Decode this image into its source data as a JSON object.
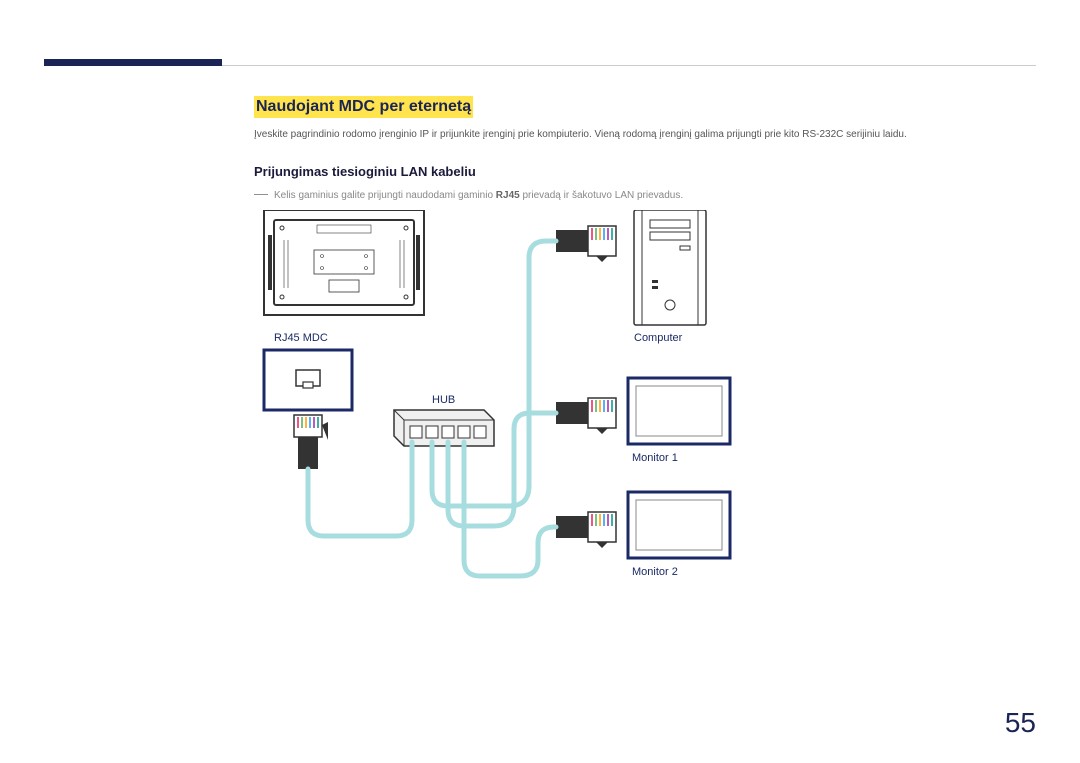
{
  "page": {
    "number": "55"
  },
  "section": {
    "title": "Naudojant MDC per eternetą",
    "intro": "Įveskite pagrindinio rodomo įrenginio IP ir prijunkite įrenginį prie kompiuterio. Vieną rodomą įrenginį galima prijungti prie kito RS-232C serijiniu laidu.",
    "sub_title": "Prijungimas tiesioginiu LAN kabeliu",
    "note_prefix": "Kelis gaminius galite prijungti naudodami gaminio ",
    "note_bold": "RJ45",
    "note_suffix": " prievadą ir šakotuvo LAN prievadus."
  },
  "diagram": {
    "rj45_mdc": "RJ45 MDC",
    "hub": "HUB",
    "computer": "Computer",
    "monitor1": "Monitor 1",
    "monitor2": "Monitor 2"
  }
}
